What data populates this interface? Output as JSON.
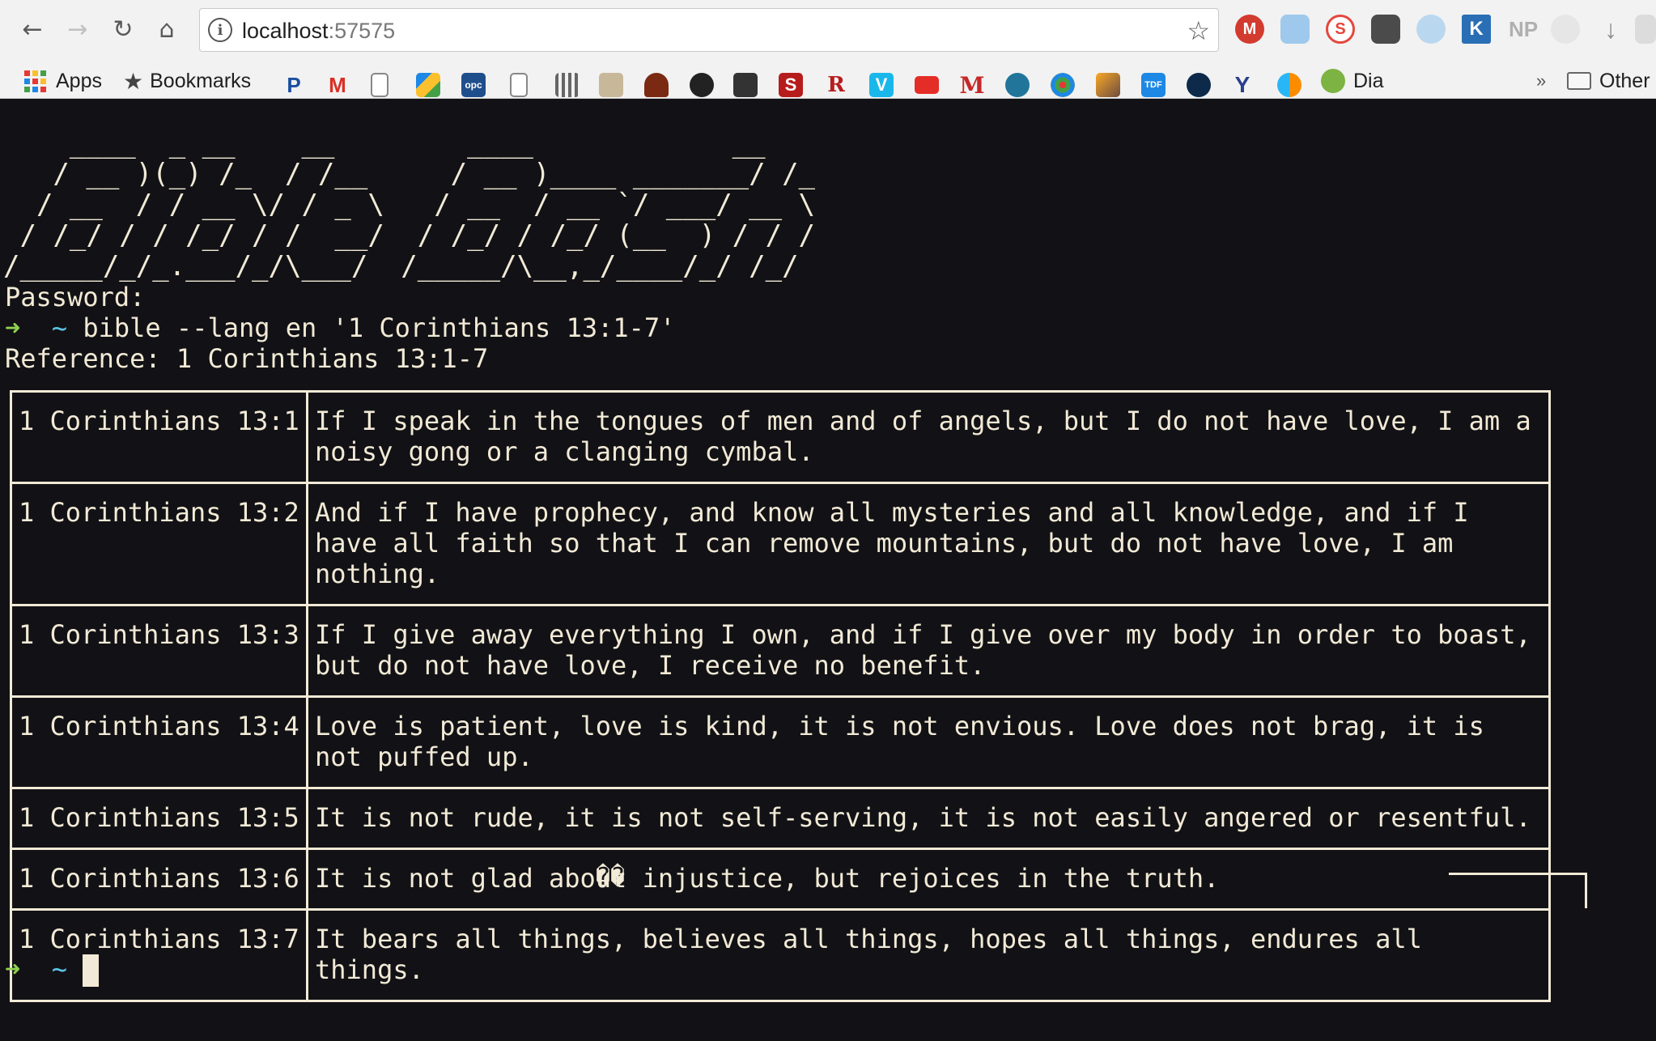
{
  "browser": {
    "url_host": "localhost",
    "url_port": ":57575",
    "bookmarks_bar": {
      "apps_label": "Apps",
      "bookmarks_label": "Bookmarks",
      "dia_label": "Dia",
      "overflow_label": "»",
      "other_label": "Other"
    },
    "extension_labels": {
      "k": "K",
      "np": "NP"
    },
    "bookmark_letters": {
      "p": "P",
      "m": "M",
      "opc": "opc",
      "s": "S",
      "r": "R",
      "v": "V",
      "m2": "M",
      "tdf": "TDF",
      "y": "Y"
    }
  },
  "terminal": {
    "ascii_banner": "    ____  _ __    __        ____            __\n   / __ )(_) /_  / /__     / __ )____ _______/ /_\n  / __  / / __ \\/ / _ \\   / __  / __ `/ ___/ __ \\\n / /_/ / / /_/ / /  __/  / /_/ / /_/ (__  ) / / /\n/_____/_/_.___/_/\\___/  /_____/\\__,_/____/_/ /_/",
    "password_prompt": "Password:",
    "prompt_arrow": "➜",
    "prompt_tilde": "~",
    "command": "bible --lang en '1 Corinthians 13:1-7'",
    "reference_line": "Reference: 1 Corinthians 13:1-7",
    "verses": [
      {
        "ref": "1 Corinthians 13:1",
        "text": "If I speak in the tongues of men and of angels, but I do not have love, I am a noisy gong or a clanging cymbal."
      },
      {
        "ref": "1 Corinthians 13:2",
        "text": "And if I have prophecy, and know all mysteries and all knowledge, and if I have all faith so that I can remove mountains, but do not have love, I am nothing."
      },
      {
        "ref": "1 Corinthians 13:3",
        "text": "If I give away everything I own, and if I give over my body in order to boast, but do not have love, I receive no benefit."
      },
      {
        "ref": "1 Corinthians 13:4",
        "text": "Love is patient, love is kind, it is not envious. Love does not brag, it is not puffed up."
      },
      {
        "ref": "1 Corinthians 13:5",
        "text": "It is not rude, it is not self-serving, it is not easily angered or resentful."
      },
      {
        "ref": "1 Corinthians 13:6",
        "text": "It is not glad about injustice, but rejoices in the truth."
      },
      {
        "ref": "1 Corinthians 13:7",
        "text": "It bears all things, believes all things, hopes all things, endures all things."
      }
    ],
    "glitch_chars": "��"
  },
  "colors": {
    "terminal_bg": "#121216",
    "terminal_fg": "#f2ead6",
    "prompt_arrow": "#8fd14f",
    "prompt_tilde": "#59c6e8"
  }
}
